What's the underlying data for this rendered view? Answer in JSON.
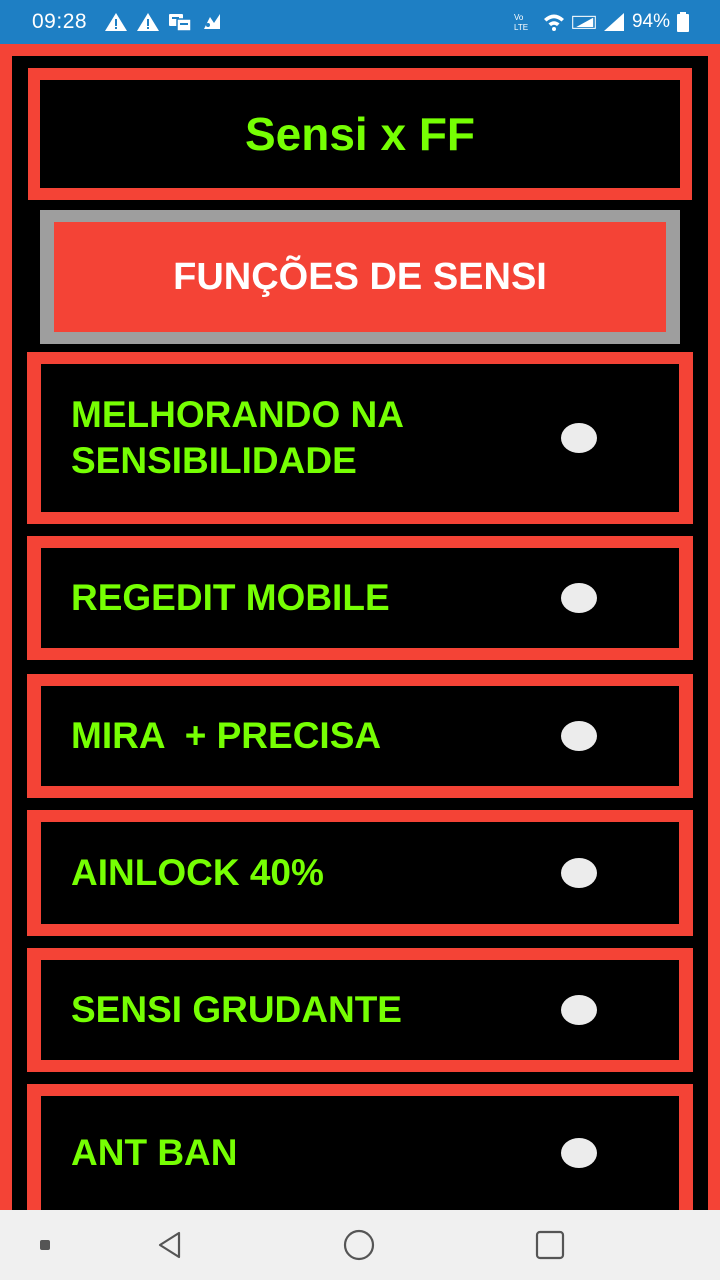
{
  "status_bar": {
    "time": "09:28",
    "battery": "94%",
    "icons_left": [
      "warning-icon",
      "warning-icon",
      "translate-icon",
      "app-icon"
    ],
    "icons_right": [
      "volte-icon",
      "wifi-icon",
      "signal-icon",
      "signal-icon",
      "battery-icon"
    ]
  },
  "app": {
    "title": "Sensi x FF",
    "section_header": "FUNÇÕES DE SENSI",
    "options": [
      {
        "label": "MELHORANDO NA\nSENSIBILIDADE",
        "on": false
      },
      {
        "label": "REGEDIT MOBILE",
        "on": false
      },
      {
        "label": "MIRA  + PRECISA",
        "on": false
      },
      {
        "label": "AINLOCK 40%",
        "on": false
      },
      {
        "label": "SENSI GRUDANTE",
        "on": false
      },
      {
        "label": "ANT BAN",
        "on": false
      }
    ]
  },
  "nav_bar": {
    "buttons": [
      "menu-dot",
      "back",
      "home",
      "recents"
    ]
  },
  "colors": {
    "status_bar": "#1e7fc4",
    "frame_red": "#f44336",
    "text_green": "#76ff03",
    "section_border": "#9e9e9e",
    "toggle": "#ececec"
  }
}
